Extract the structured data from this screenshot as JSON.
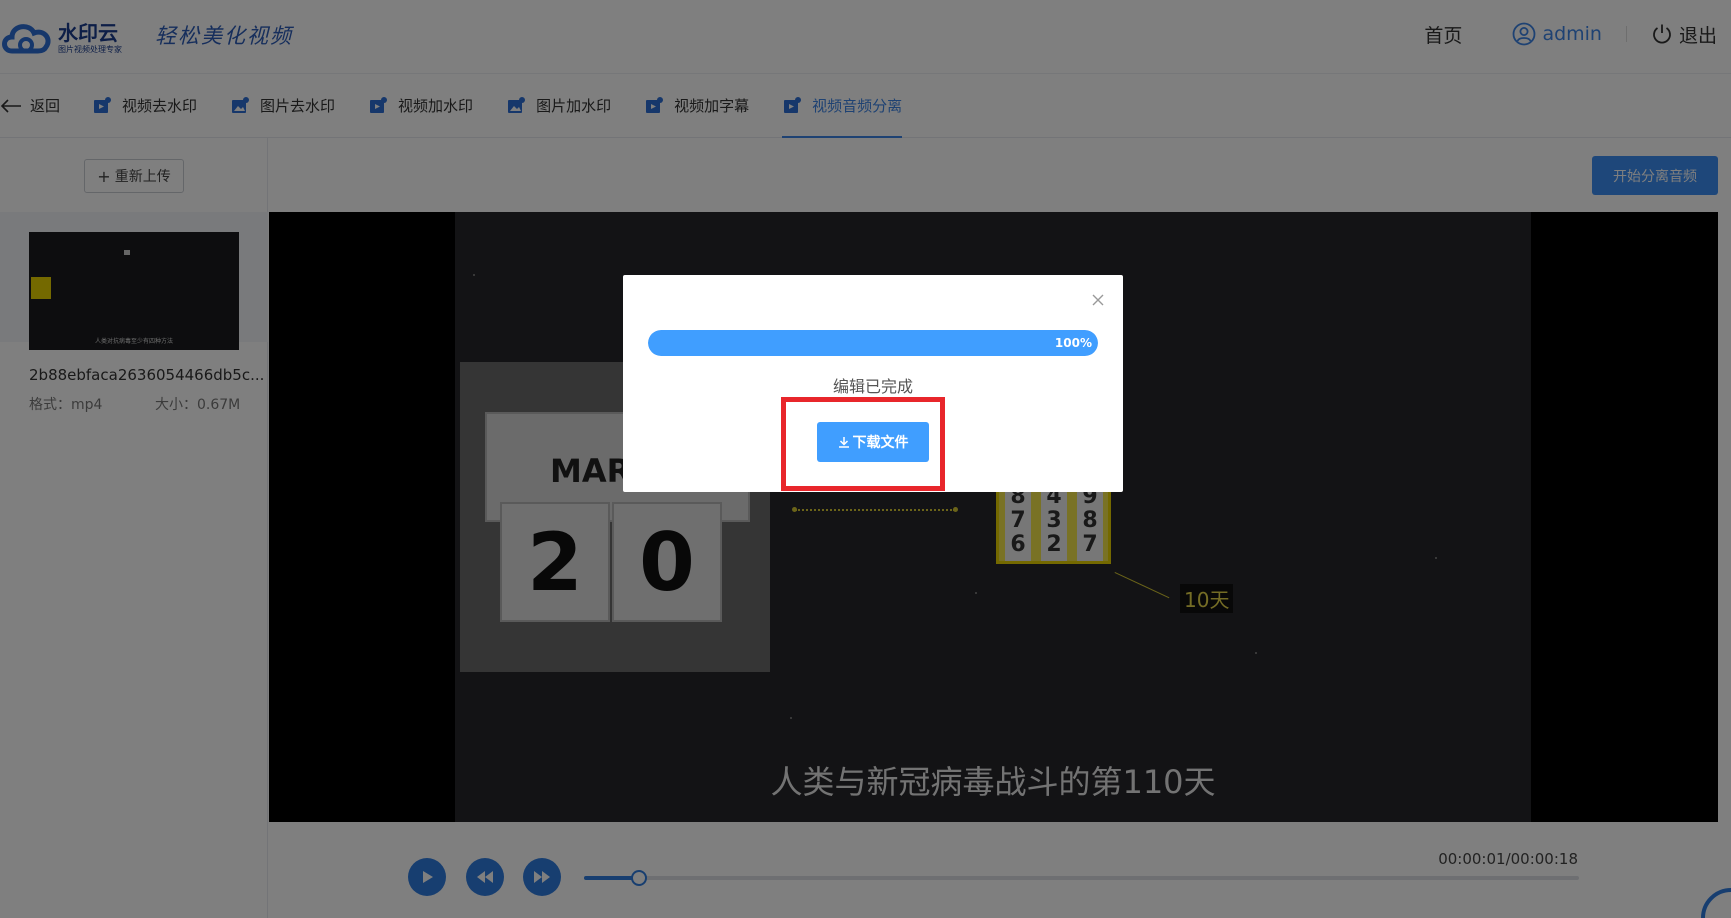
{
  "header": {
    "logo_name": "水印云",
    "logo_sub": "图片视频处理专家",
    "slogan": "轻松美化视频",
    "nav_home": "首页",
    "user_name": "admin",
    "logout": "退出"
  },
  "tabs": {
    "back": "返回",
    "items": [
      {
        "label": "视频去水印",
        "icon": "video-icon"
      },
      {
        "label": "图片去水印",
        "icon": "image-icon"
      },
      {
        "label": "视频加水印",
        "icon": "video-icon"
      },
      {
        "label": "图片加水印",
        "icon": "image-icon"
      },
      {
        "label": "视频加字幕",
        "icon": "video-icon"
      },
      {
        "label": "视频音频分离",
        "icon": "video-icon",
        "active": true
      }
    ]
  },
  "sidebar": {
    "reupload_label": "重新上传",
    "file": {
      "name": "2b88ebfaca2636054466db5c...",
      "format": "格式：mp4",
      "size": "大小：0.67M",
      "thumb_caption": "人类对抗病毒至少有四种方法"
    }
  },
  "main": {
    "start_button": "开始分离音频",
    "video": {
      "calendar_month": "MARC",
      "calendar_day_1": "2",
      "calendar_day_2": "0",
      "combo_col1": "8 7 6",
      "combo_col2": "4 3 2",
      "combo_col3": "9 8 7",
      "label": "10天",
      "subtitle": "人类与新冠病毒战斗的第110天"
    },
    "player": {
      "time": "00:00:01/00:00:18",
      "progress": 0.055
    }
  },
  "modal": {
    "progress": 1.0,
    "progress_label": "100%",
    "status": "编辑已完成",
    "download_label": "下载文件"
  },
  "colors": {
    "accent": "#409eff",
    "highlight": "#e8262b"
  }
}
